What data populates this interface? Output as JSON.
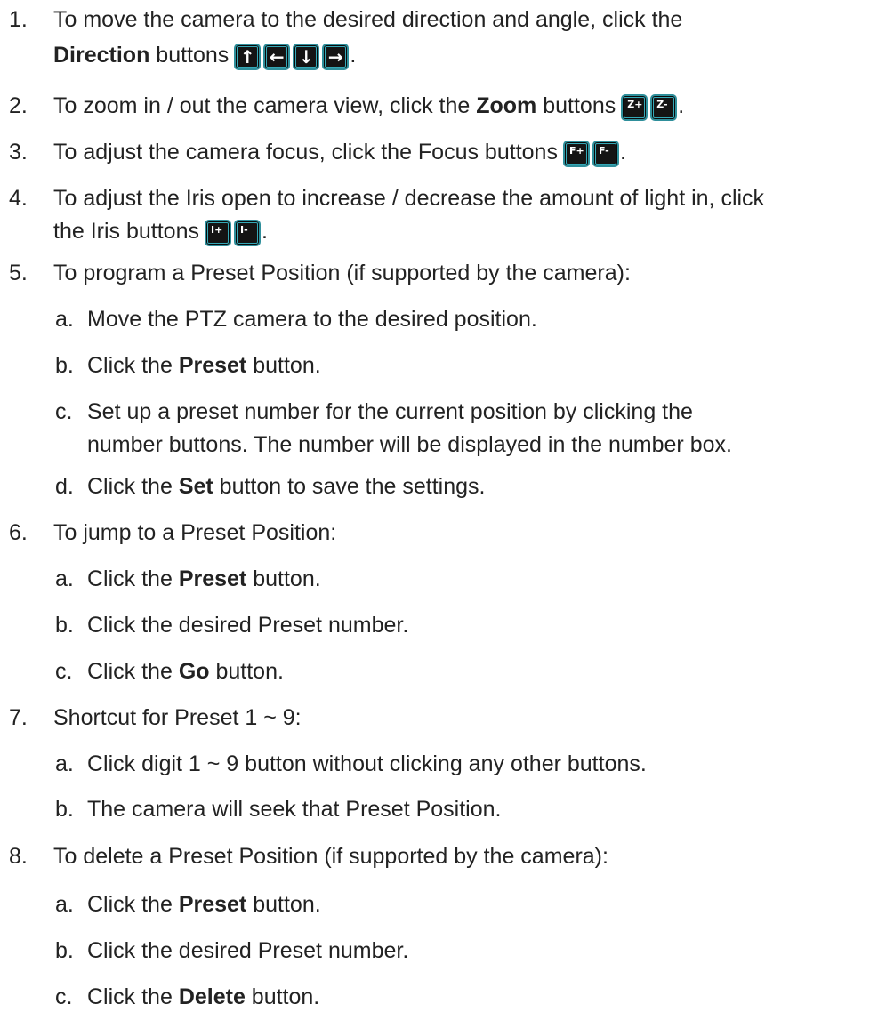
{
  "steps": [
    {
      "num": "1.",
      "lines": [
        "To move the camera to the desired direction and angle, click the"
      ],
      "direction_label": "Direction",
      "after_label": " buttons",
      "icons": [
        {
          "name": "arrow-up-icon",
          "glyph": "↑"
        },
        {
          "name": "arrow-left-icon",
          "glyph": "←"
        },
        {
          "name": "arrow-down-icon",
          "glyph": "↓"
        },
        {
          "name": "arrow-right-icon",
          "glyph": "→"
        }
      ]
    },
    {
      "num": "2.",
      "before": "To zoom in / out the camera view, click the ",
      "bold": "Zoom",
      "after": " buttons",
      "icons": [
        {
          "name": "zoom-in-icon",
          "glyph": "Z+"
        },
        {
          "name": "zoom-out-icon",
          "glyph": "Z-"
        }
      ]
    },
    {
      "num": "3.",
      "before": "To adjust the camera focus, click the Focus buttons",
      "icons": [
        {
          "name": "focus-plus-icon",
          "glyph": "F+"
        },
        {
          "name": "focus-minus-icon",
          "glyph": "F-"
        }
      ]
    },
    {
      "num": "4.",
      "line1": "To adjust the Iris open to increase / decrease the amount of light in, click",
      "line2": "the Iris buttons",
      "icons": [
        {
          "name": "iris-open-icon",
          "glyph": "I+"
        },
        {
          "name": "iris-close-icon",
          "glyph": "I-"
        }
      ]
    },
    {
      "num": "5.",
      "text": "To program a Preset Position (if supported by the camera):",
      "sub": [
        {
          "letter": "a.",
          "text": "Move the PTZ camera to the desired position."
        },
        {
          "letter": "b.",
          "before": "Click the ",
          "bold": "Preset",
          "after": " button."
        },
        {
          "letter": "c.",
          "line1": "Set up a preset number for the current position by clicking the",
          "line2": "number buttons. The number will be displayed in the number box."
        },
        {
          "letter": "d.",
          "before": "Click the ",
          "bold": "Set",
          "after": " button to save the settings."
        }
      ]
    },
    {
      "num": "6.",
      "text": "To jump to a Preset Position:",
      "sub": [
        {
          "letter": "a.",
          "before": "Click the ",
          "bold": "Preset",
          "after": " button."
        },
        {
          "letter": "b.",
          "text": "Click the desired Preset number."
        },
        {
          "letter": "c.",
          "before": "Click the ",
          "bold": "Go",
          "after": " button."
        }
      ]
    },
    {
      "num": "7.",
      "text": "Shortcut for Preset 1 ~ 9:",
      "sub": [
        {
          "letter": "a.",
          "text": "Click digit 1 ~ 9 button without clicking any other buttons."
        },
        {
          "letter": "b.",
          "text": "The camera will seek that Preset Position."
        }
      ]
    },
    {
      "num": "8.",
      "text": "To delete a Preset Position (if supported by the camera):",
      "sub": [
        {
          "letter": "a.",
          "before": "Click the ",
          "bold": "Preset",
          "after": " button."
        },
        {
          "letter": "b.",
          "text": "Click the desired Preset number."
        },
        {
          "letter": "c.",
          "before": "Click the ",
          "bold": "Delete",
          "after": " button."
        }
      ]
    }
  ],
  "period": "."
}
